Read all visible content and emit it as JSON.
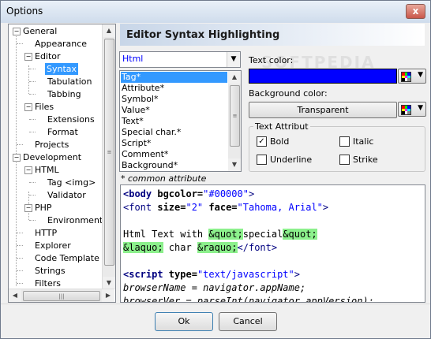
{
  "window": {
    "title": "Options",
    "close_glyph": "x"
  },
  "tree": {
    "items": [
      {
        "label": "General"
      },
      {
        "label": "Appearance"
      },
      {
        "label": "Editor"
      },
      {
        "label": "Syntax"
      },
      {
        "label": "Tabulation"
      },
      {
        "label": "Tabbing"
      },
      {
        "label": "Files"
      },
      {
        "label": "Extensions"
      },
      {
        "label": "Format"
      },
      {
        "label": "Projects"
      },
      {
        "label": "Development"
      },
      {
        "label": "HTML"
      },
      {
        "label": "Tag <img>"
      },
      {
        "label": "Validator"
      },
      {
        "label": "PHP"
      },
      {
        "label": "Environment"
      },
      {
        "label": "HTTP"
      },
      {
        "label": "Explorer"
      },
      {
        "label": "Code Template"
      },
      {
        "label": "Strings"
      },
      {
        "label": "Filters"
      }
    ],
    "selected": "Syntax"
  },
  "panel": {
    "title": "Editor Syntax Highlighting"
  },
  "language_select": {
    "value": "Html"
  },
  "elements": {
    "items": [
      "Tag*",
      "Attribute*",
      "Symbol*",
      "Value*",
      "Text*",
      "Special char.*",
      "Script*",
      "Comment*",
      "Background*"
    ],
    "selected": "Tag*"
  },
  "note": "* common attribute",
  "text_color": {
    "label": "Text color:",
    "value": "#0000ff"
  },
  "background_color": {
    "label": "Background color:",
    "button_label": "Transparent"
  },
  "text_attribut": {
    "title": "Text Attribut",
    "bold": {
      "label": "Bold",
      "checked": true
    },
    "italic": {
      "label": "Italic",
      "checked": false
    },
    "underline": {
      "label": "Underline",
      "checked": false
    },
    "strike": {
      "label": "Strike",
      "checked": false
    }
  },
  "preview": {
    "l1_tag_open": "<body",
    "l1_attr": " bgcolor=",
    "l1_val": "\"#00000\"",
    "l1_close": ">",
    "l2_tag_open": "<font",
    "l2_attr1": " size=",
    "l2_val1": "\"2\"",
    "l2_attr2": " face=",
    "l2_val2": "\"Tahoma, Arial\"",
    "l2_close": ">",
    "l4_text1": "Html Text with ",
    "l4_sp1": "&quot;",
    "l4_text2": "special",
    "l4_sp2": "&quot;",
    "l5_sp1": "&laquo;",
    "l5_text": " char ",
    "l5_sp2": "&raquo;",
    "l5_tag": "</font>",
    "l7_tag_open": "<script",
    "l7_attr": " type=",
    "l7_val": "\"text/javascript\"",
    "l7_close": ">",
    "l8": "browserName = navigator.appName;",
    "l9": "browserVer = parseInt(navigator.appVersion);"
  },
  "buttons": {
    "ok": "Ok",
    "cancel": "Cancel"
  },
  "watermark": "SOFTPEDIA"
}
